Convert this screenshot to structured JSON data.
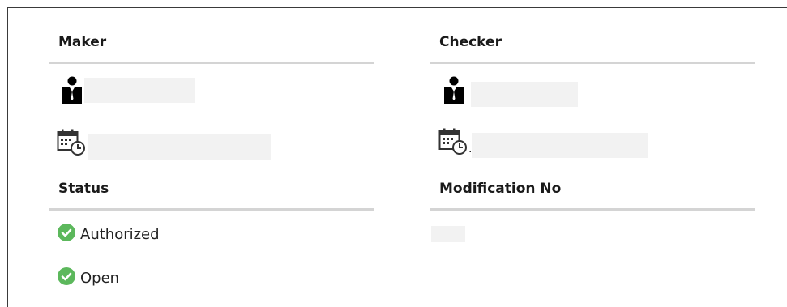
{
  "maker": {
    "title": "Maker",
    "user_icon": "user-icon",
    "date_icon": "calendar-clock-icon"
  },
  "checker": {
    "title": "Checker",
    "user_icon": "user-icon",
    "date_icon": "calendar-clock-icon",
    "date_prefix": "."
  },
  "status": {
    "title": "Status",
    "items": [
      {
        "label": "Authorized",
        "icon": "check-circle-icon"
      },
      {
        "label": "Open",
        "icon": "check-circle-icon"
      }
    ]
  },
  "modification": {
    "title": "Modification No"
  },
  "colors": {
    "check_green": "#5cb85c",
    "rule_gray": "#d4d4d4",
    "redacted_bg": "#f2f2f2"
  }
}
